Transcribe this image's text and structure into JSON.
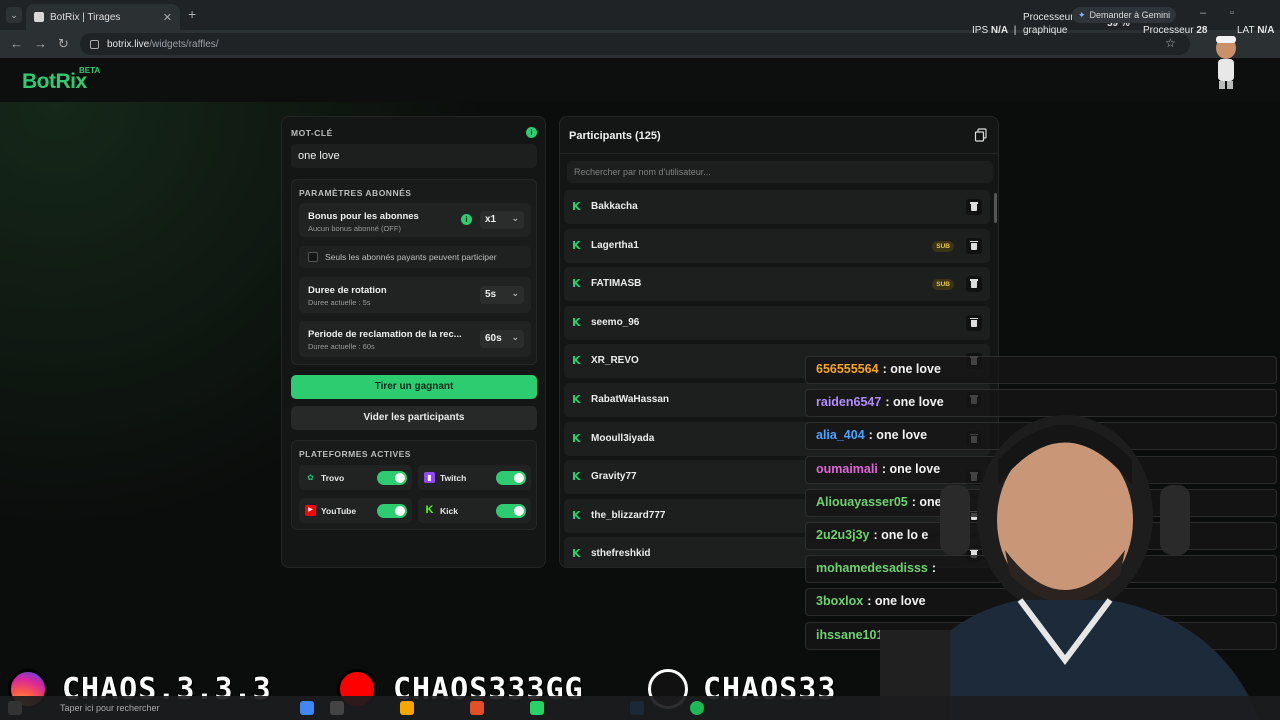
{
  "browser": {
    "tab_title": "BotRix | Tirages",
    "url_host": "botrix.live",
    "url_path": "/widgets/raffles/"
  },
  "hud": {
    "ips_label": "IPS",
    "ips_value": "N/A",
    "proc_label_1": "Processeur",
    "proc_label_2": "graphique",
    "proc_pct": "59 %",
    "proc_label_3": "Processeur",
    "proc_value": "28",
    "lat_label": "LAT",
    "lat_value": "N/A",
    "gemini": "Demander à Gemini"
  },
  "app": {
    "logo": "BotRix",
    "beta": "BETA"
  },
  "left_panel": {
    "keyword_label": "MOT-CLÉ",
    "keyword_value": "one love",
    "sub_settings_label": "PARAMÈTRES ABONNÉS",
    "bonus_title": "Bonus pour les abonnes",
    "bonus_sub": "Aucun bonus abonné (OFF)",
    "bonus_value": "x1",
    "paid_only_label": "Seuls les abonnés payants peuvent participer",
    "rotation_title": "Duree de rotation",
    "rotation_sub": "Duree actuelle : 5s",
    "rotation_value": "5s",
    "claim_title": "Periode de reclamation de la rec...",
    "claim_sub": "Duree actuelle : 60s",
    "claim_value": "60s",
    "draw_button": "Tirer un gagnant",
    "clear_button": "Vider les participants",
    "platforms_label": "PLATEFORMES ACTIVES",
    "platforms": [
      {
        "name": "Trovo",
        "color": "#21c77a"
      },
      {
        "name": "Twitch",
        "color": "#9146ff"
      },
      {
        "name": "YouTube",
        "color": "#ff0000"
      },
      {
        "name": "Kick",
        "color": "#53fc18"
      }
    ]
  },
  "right_panel": {
    "title": "Participants (125)",
    "search_placeholder": "Rechercher par nom d'utilisateur...",
    "participants": [
      {
        "name": "Bakkacha",
        "sub": false
      },
      {
        "name": "Lagertha1",
        "sub": true
      },
      {
        "name": "FATIMASB",
        "sub": true
      },
      {
        "name": "seemo_96",
        "sub": false
      },
      {
        "name": "XR_REVO",
        "sub": false
      },
      {
        "name": "RabatWaHassan",
        "sub": false
      },
      {
        "name": "Mooull3iyada",
        "sub": false
      },
      {
        "name": "Gravity77",
        "sub": false
      },
      {
        "name": "the_blizzard777",
        "sub": false
      },
      {
        "name": "sthefreshkid",
        "sub": false
      }
    ],
    "sub_badge": "SUB"
  },
  "chat": [
    {
      "user": "656555564",
      "text": ": one love",
      "color": "#f5a623"
    },
    {
      "user": "raiden6547",
      "text": ": one love",
      "color": "#b58cff"
    },
    {
      "user": "alia_404",
      "text": ": one love",
      "color": "#4aa3ff"
    },
    {
      "user": "oumaimali",
      "text": ": one love",
      "color": "#e066d6"
    },
    {
      "user": "Aliouayasser05",
      "text": ": one l",
      "color": "#6fd16f"
    },
    {
      "user": "2u2u3j3y",
      "text": ": one lo e",
      "color": "#6fd16f"
    },
    {
      "user": "mohamedesadisss",
      "text": ":",
      "color": "#6fd16f"
    },
    {
      "user": "3boxlox",
      "text": ": one love",
      "color": "#6fd16f"
    },
    {
      "user": "ihssane101",
      "text": "",
      "color": "#6fd16f"
    }
  ],
  "banner": {
    "instagram": "CHAOS.3.3.3",
    "youtube": "CHAOS333GG",
    "kick": "CHAOS33"
  },
  "taskbar": {
    "search_placeholder": "Taper ici pour rechercher"
  }
}
